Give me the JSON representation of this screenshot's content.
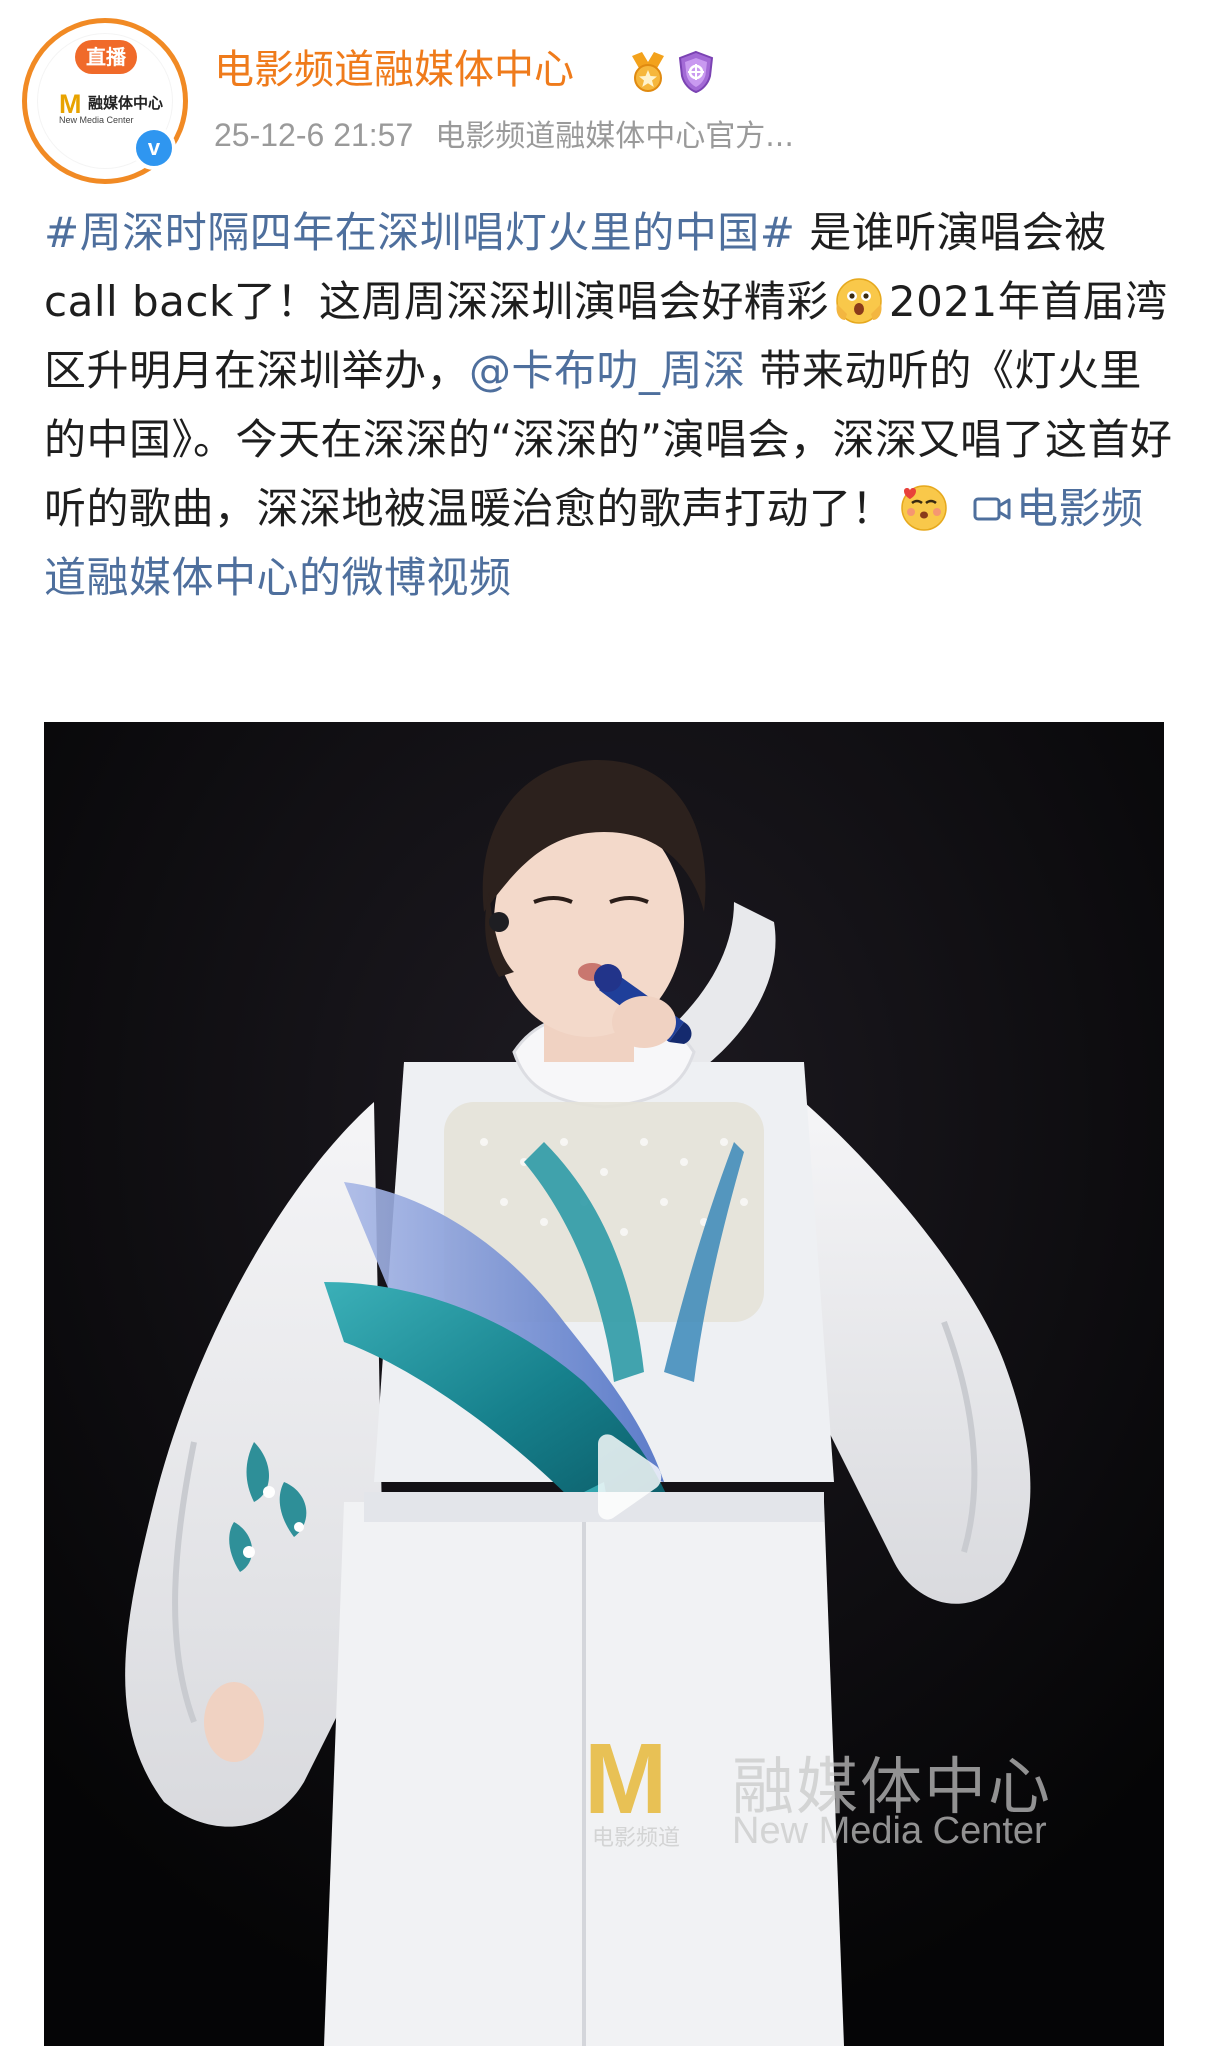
{
  "post": {
    "author": {
      "name": "电影频道融媒体中心",
      "live_badge": "直播",
      "avatar_logo_mark": "M",
      "avatar_logo_text": "融媒体中心",
      "avatar_logo_sub": "New Media Center",
      "verified": true,
      "badges": [
        "gold-medal-icon",
        "purple-shield-icon"
      ]
    },
    "timestamp": "25-12-6 21:57",
    "source": "电影频道融媒体中心官方...",
    "text": {
      "hashtag": "#周深时隔四年在深圳唱灯火里的中国#",
      "part1": " 是谁听演唱会被call back了！这周周深深圳演唱会好精彩",
      "part2": "2021年首届湾区升明月在深圳举办，",
      "mention": "@卡布叻_周深",
      "part3": " 带来动听的《灯火里的中国》。今天在深深的“深深的”演唱会，深深又唱了这首好听的歌曲，深深地被温暖治愈的歌声打动了！",
      "video_link": "电影频道融媒体中心的微博视频"
    },
    "emojis": [
      "shocked-emoji",
      "touched-emoji"
    ],
    "video": {
      "watermark_mark": "M",
      "watermark_channel": "电影频道",
      "watermark_cn": "融媒体中心",
      "watermark_en": "New Media Center"
    }
  },
  "colors": {
    "username": "#ef7b1b",
    "link": "#4e6f9d",
    "meta": "#9a9a9a",
    "live_badge": "#f06a2a",
    "verified": "#2f96f0"
  }
}
